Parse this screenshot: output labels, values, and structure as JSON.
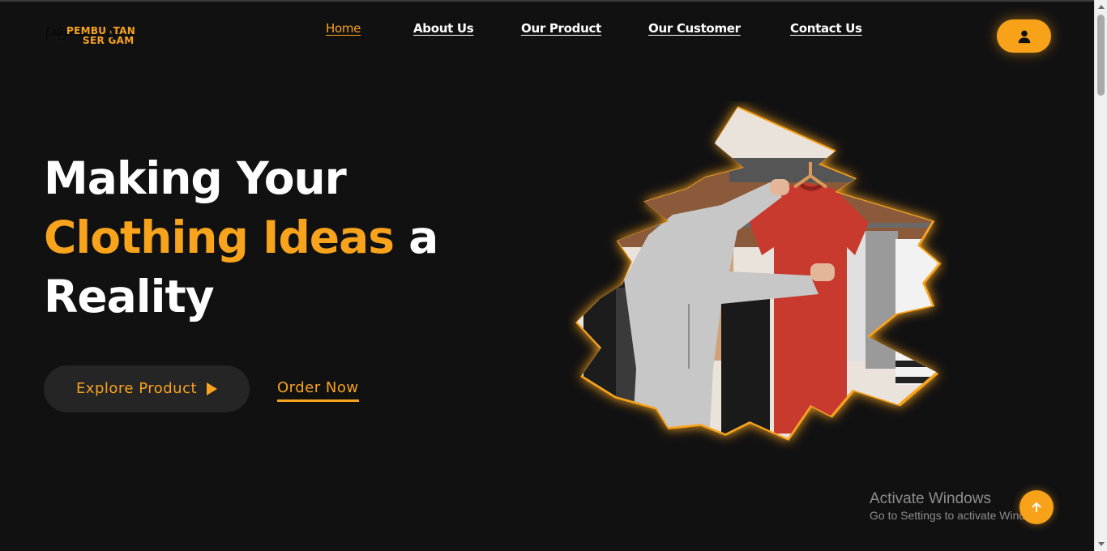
{
  "brand": {
    "logo_initials": "PS",
    "logo_line1": "PEMBUATAN",
    "logo_line2": "SER GAM",
    "logo_big_letter": "A"
  },
  "nav": {
    "items": [
      {
        "label": "Home",
        "active": true
      },
      {
        "label": "About Us",
        "active": false
      },
      {
        "label": "Our Product",
        "active": false
      },
      {
        "label": "Our Customer",
        "active": false
      },
      {
        "label": "Contact Us",
        "active": false
      }
    ],
    "user_icon": "user-icon"
  },
  "hero": {
    "title_line1": "Making Your",
    "title_accent": "Clothing Ideas",
    "title_after_accent": " a",
    "title_line3": "Reality",
    "explore_label": "Explore Product",
    "order_label": "Order Now",
    "image_description_icon": "clothing-photo"
  },
  "watermark": {
    "title": "Activate Windows",
    "subtitle": "Go to Settings to activate Windows."
  },
  "colors": {
    "background": "#121112",
    "accent": "#f7a31c",
    "button_dark": "#262526",
    "text": "#ffffff"
  }
}
